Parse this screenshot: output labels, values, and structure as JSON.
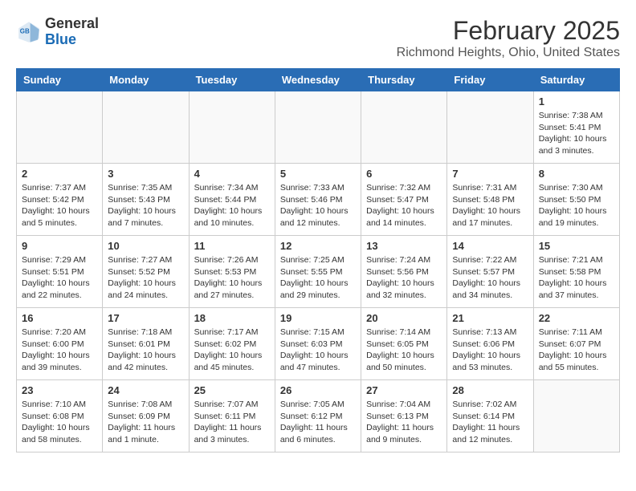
{
  "header": {
    "logo_general": "General",
    "logo_blue": "Blue",
    "month_title": "February 2025",
    "location": "Richmond Heights, Ohio, United States"
  },
  "weekdays": [
    "Sunday",
    "Monday",
    "Tuesday",
    "Wednesday",
    "Thursday",
    "Friday",
    "Saturday"
  ],
  "weeks": [
    [
      {
        "day": "",
        "info": ""
      },
      {
        "day": "",
        "info": ""
      },
      {
        "day": "",
        "info": ""
      },
      {
        "day": "",
        "info": ""
      },
      {
        "day": "",
        "info": ""
      },
      {
        "day": "",
        "info": ""
      },
      {
        "day": "1",
        "info": "Sunrise: 7:38 AM\nSunset: 5:41 PM\nDaylight: 10 hours and 3 minutes."
      }
    ],
    [
      {
        "day": "2",
        "info": "Sunrise: 7:37 AM\nSunset: 5:42 PM\nDaylight: 10 hours and 5 minutes."
      },
      {
        "day": "3",
        "info": "Sunrise: 7:35 AM\nSunset: 5:43 PM\nDaylight: 10 hours and 7 minutes."
      },
      {
        "day": "4",
        "info": "Sunrise: 7:34 AM\nSunset: 5:44 PM\nDaylight: 10 hours and 10 minutes."
      },
      {
        "day": "5",
        "info": "Sunrise: 7:33 AM\nSunset: 5:46 PM\nDaylight: 10 hours and 12 minutes."
      },
      {
        "day": "6",
        "info": "Sunrise: 7:32 AM\nSunset: 5:47 PM\nDaylight: 10 hours and 14 minutes."
      },
      {
        "day": "7",
        "info": "Sunrise: 7:31 AM\nSunset: 5:48 PM\nDaylight: 10 hours and 17 minutes."
      },
      {
        "day": "8",
        "info": "Sunrise: 7:30 AM\nSunset: 5:50 PM\nDaylight: 10 hours and 19 minutes."
      }
    ],
    [
      {
        "day": "9",
        "info": "Sunrise: 7:29 AM\nSunset: 5:51 PM\nDaylight: 10 hours and 22 minutes."
      },
      {
        "day": "10",
        "info": "Sunrise: 7:27 AM\nSunset: 5:52 PM\nDaylight: 10 hours and 24 minutes."
      },
      {
        "day": "11",
        "info": "Sunrise: 7:26 AM\nSunset: 5:53 PM\nDaylight: 10 hours and 27 minutes."
      },
      {
        "day": "12",
        "info": "Sunrise: 7:25 AM\nSunset: 5:55 PM\nDaylight: 10 hours and 29 minutes."
      },
      {
        "day": "13",
        "info": "Sunrise: 7:24 AM\nSunset: 5:56 PM\nDaylight: 10 hours and 32 minutes."
      },
      {
        "day": "14",
        "info": "Sunrise: 7:22 AM\nSunset: 5:57 PM\nDaylight: 10 hours and 34 minutes."
      },
      {
        "day": "15",
        "info": "Sunrise: 7:21 AM\nSunset: 5:58 PM\nDaylight: 10 hours and 37 minutes."
      }
    ],
    [
      {
        "day": "16",
        "info": "Sunrise: 7:20 AM\nSunset: 6:00 PM\nDaylight: 10 hours and 39 minutes."
      },
      {
        "day": "17",
        "info": "Sunrise: 7:18 AM\nSunset: 6:01 PM\nDaylight: 10 hours and 42 minutes."
      },
      {
        "day": "18",
        "info": "Sunrise: 7:17 AM\nSunset: 6:02 PM\nDaylight: 10 hours and 45 minutes."
      },
      {
        "day": "19",
        "info": "Sunrise: 7:15 AM\nSunset: 6:03 PM\nDaylight: 10 hours and 47 minutes."
      },
      {
        "day": "20",
        "info": "Sunrise: 7:14 AM\nSunset: 6:05 PM\nDaylight: 10 hours and 50 minutes."
      },
      {
        "day": "21",
        "info": "Sunrise: 7:13 AM\nSunset: 6:06 PM\nDaylight: 10 hours and 53 minutes."
      },
      {
        "day": "22",
        "info": "Sunrise: 7:11 AM\nSunset: 6:07 PM\nDaylight: 10 hours and 55 minutes."
      }
    ],
    [
      {
        "day": "23",
        "info": "Sunrise: 7:10 AM\nSunset: 6:08 PM\nDaylight: 10 hours and 58 minutes."
      },
      {
        "day": "24",
        "info": "Sunrise: 7:08 AM\nSunset: 6:09 PM\nDaylight: 11 hours and 1 minute."
      },
      {
        "day": "25",
        "info": "Sunrise: 7:07 AM\nSunset: 6:11 PM\nDaylight: 11 hours and 3 minutes."
      },
      {
        "day": "26",
        "info": "Sunrise: 7:05 AM\nSunset: 6:12 PM\nDaylight: 11 hours and 6 minutes."
      },
      {
        "day": "27",
        "info": "Sunrise: 7:04 AM\nSunset: 6:13 PM\nDaylight: 11 hours and 9 minutes."
      },
      {
        "day": "28",
        "info": "Sunrise: 7:02 AM\nSunset: 6:14 PM\nDaylight: 11 hours and 12 minutes."
      },
      {
        "day": "",
        "info": ""
      }
    ]
  ]
}
